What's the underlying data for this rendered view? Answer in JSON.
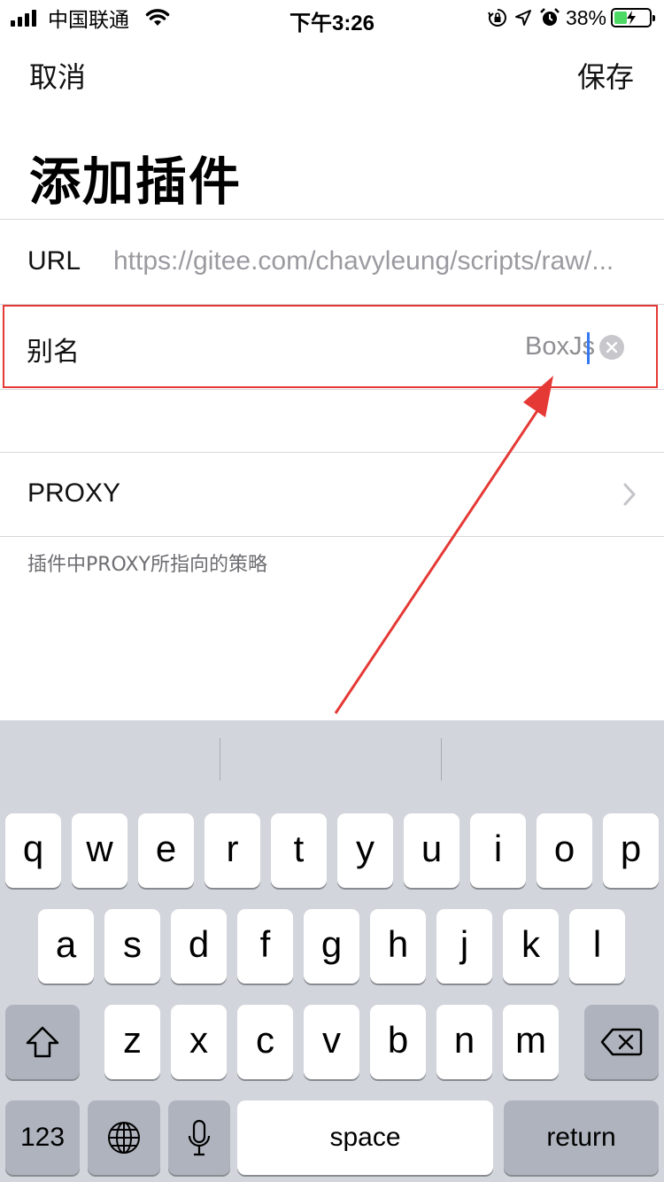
{
  "status_bar": {
    "carrier": "中国联通",
    "time": "下午3:26",
    "battery_percent": "38%",
    "battery_level": 0.38,
    "icons": [
      "signal-icon",
      "wifi-icon",
      "orientation-lock-icon",
      "location-icon",
      "alarm-icon",
      "battery-charging-icon"
    ]
  },
  "nav": {
    "cancel_label": "取消",
    "save_label": "保存"
  },
  "title": "添加插件",
  "form": {
    "url_label": "URL",
    "url_value": "https://gitee.com/chavyleung/scripts/raw/...",
    "alias_label": "别名",
    "alias_value": "BoxJs",
    "proxy_label": "PROXY",
    "proxy_footnote": "插件中PROXY所指向的策略"
  },
  "keyboard": {
    "row1": [
      "q",
      "w",
      "e",
      "r",
      "t",
      "y",
      "u",
      "i",
      "o",
      "p"
    ],
    "row2": [
      "a",
      "s",
      "d",
      "f",
      "g",
      "h",
      "j",
      "k",
      "l"
    ],
    "row3": [
      "z",
      "x",
      "c",
      "v",
      "b",
      "n",
      "m"
    ],
    "numbers_label": "123",
    "space_label": "space",
    "return_label": "return"
  },
  "colors": {
    "highlight_border": "#e53935",
    "arrow": "#e53935",
    "caret": "#3478f6",
    "keyboard_bg": "#d2d5db"
  }
}
